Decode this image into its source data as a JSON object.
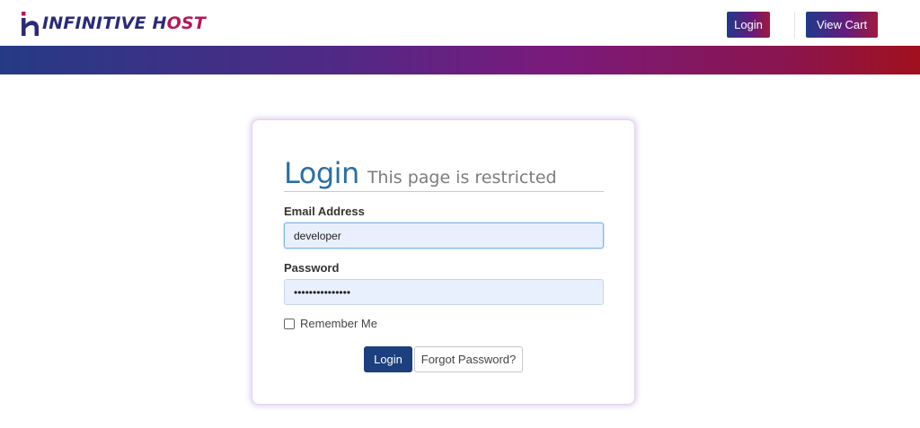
{
  "header": {
    "logo": {
      "text_main": "INFINITIVE H",
      "text_accent": "OST",
      "icon": "brand-logo-icon"
    },
    "login_label": "Login",
    "cart_label": "View Cart"
  },
  "login_card": {
    "title": "Login",
    "subtitle": "This page is restricted",
    "email_label": "Email Address",
    "email_value": "developer",
    "password_label": "Password",
    "password_value": "•••••••••••••••",
    "remember_label": "Remember Me",
    "remember_checked": false,
    "submit_label": "Login",
    "forgot_label": "Forgot Password?"
  },
  "colors": {
    "brand_blue": "#1c3f7d",
    "heading_blue": "#2a6fa3",
    "band_start": "#253a86",
    "band_end": "#a0101e"
  }
}
